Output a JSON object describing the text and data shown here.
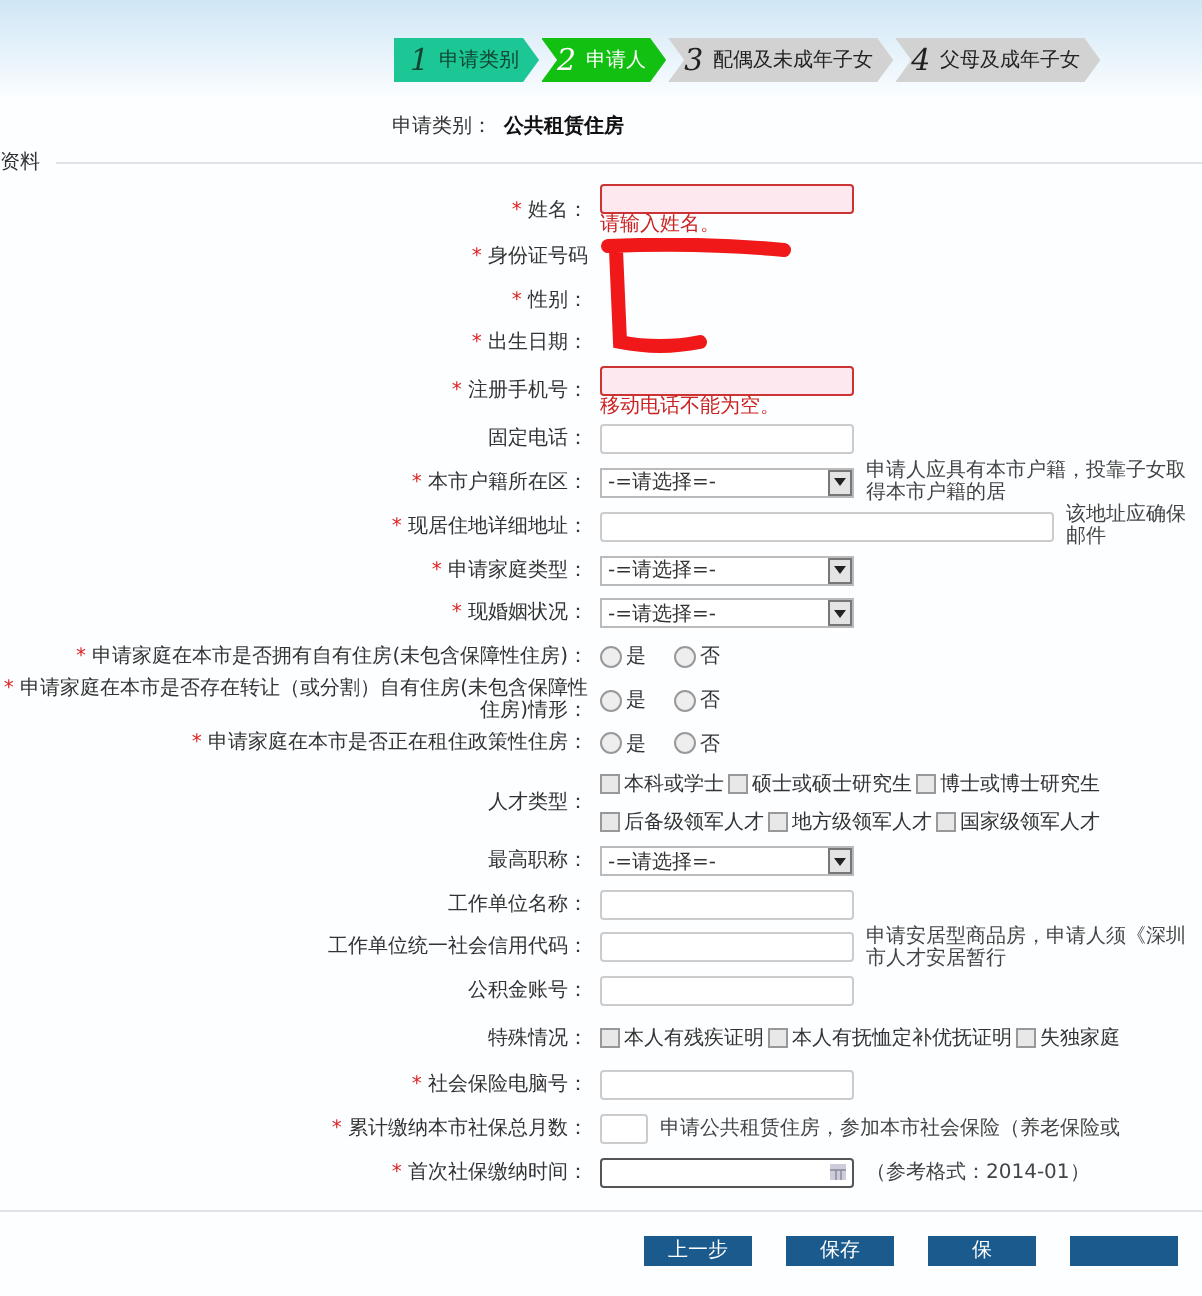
{
  "steps": [
    {
      "number": "1",
      "label": "申请类别",
      "selected": false,
      "done": true
    },
    {
      "number": "2",
      "label": "申请人",
      "selected": true,
      "done": false
    },
    {
      "number": "3",
      "label": "配偶及未成年子女",
      "selected": false,
      "done": false
    },
    {
      "number": "4",
      "label": "父母及成年子女",
      "selected": false,
      "done": false
    }
  ],
  "category": {
    "label": "申请类别：",
    "value": "公共租赁住房"
  },
  "section": {
    "title": "资料"
  },
  "rows": [
    {
      "kind": "text",
      "mark": "*",
      "label": "姓名：",
      "error": true,
      "error_message": "请输入姓名。"
    },
    {
      "kind": "redacted",
      "mark": "*",
      "label": "身份证号码"
    },
    {
      "kind": "redacted",
      "mark": "*",
      "label": "性别："
    },
    {
      "kind": "redacted",
      "mark": "*",
      "label": "出生日期："
    },
    {
      "kind": "text",
      "mark": "*",
      "label": "注册手机号：",
      "error": true,
      "error_message": "移动电话不能为空。"
    },
    {
      "kind": "text",
      "label": "固定电话：",
      "error": false
    },
    {
      "kind": "select",
      "mark": "*",
      "label": "本市户籍所在区：",
      "value": "-=请选择=-",
      "hint": "申请人应具有本市户籍，投靠子女取得本市户籍的居"
    },
    {
      "kind": "wide",
      "mark": "*",
      "label": "现居住地详细地址：",
      "error": false,
      "hint": "该地址应确保邮件"
    },
    {
      "kind": "select",
      "mark": "*",
      "label": "申请家庭类型：",
      "value": "-=请选择=-"
    },
    {
      "kind": "select",
      "mark": "*",
      "label": "现婚姻状况：",
      "value": "-=请选择=-"
    },
    {
      "kind": "radio",
      "mark": "*",
      "label": "申请家庭在本市是否拥有自有住房(未包含保障性住房)：",
      "options": [
        {
          "label": "是",
          "selected": false
        },
        {
          "label": "否",
          "selected": false
        }
      ]
    },
    {
      "kind": "radio",
      "mark": "*",
      "label": "申请家庭在本市是否存在转让（或分割）自有住房(未包含保障性住房)情形：",
      "options": [
        {
          "label": "是",
          "selected": false
        },
        {
          "label": "否",
          "selected": false
        }
      ]
    },
    {
      "kind": "radio",
      "mark": "*",
      "label": "申请家庭在本市是否正在租住政策性住房：",
      "options": [
        {
          "label": "是",
          "selected": false
        },
        {
          "label": "否",
          "selected": false
        }
      ]
    },
    {
      "kind": "checkbox",
      "label": "人才类型：",
      "options": [
        {
          "label": "本科或学士",
          "checked": false
        },
        {
          "label": "硕士或硕士研究生",
          "checked": false
        },
        {
          "label": "博士或博士研究生",
          "checked": false
        },
        {
          "label": "后备级领军人才",
          "checked": false
        },
        {
          "label": "地方级领军人才",
          "checked": false
        },
        {
          "label": "国家级领军人才",
          "checked": false
        }
      ]
    },
    {
      "kind": "select",
      "label": "最高职称：",
      "value": "-=请选择=-"
    },
    {
      "kind": "text",
      "label": "工作单位名称：",
      "error": false
    },
    {
      "kind": "text",
      "label": "工作单位统一社会信用代码：",
      "error": false,
      "hint": "申请安居型商品房，申请人须《深圳市人才安居暂行"
    },
    {
      "kind": "text",
      "label": "公积金账号：",
      "error": false
    },
    {
      "kind": "checkbox",
      "label": "特殊情况：",
      "options": [
        {
          "label": "本人有残疾证明",
          "checked": false
        },
        {
          "label": "本人有抚恤定补优抚证明",
          "checked": false
        },
        {
          "label": "失独家庭",
          "checked": false
        }
      ]
    },
    {
      "kind": "text",
      "mark": "*",
      "label": "社会保险电脑号：",
      "error": false
    },
    {
      "kind": "short",
      "mark": "*",
      "label": "累计缴纳本市社保总月数：",
      "error": false,
      "hint": "申请公共租赁住房，参加本市社会保险（养老保险或"
    },
    {
      "kind": "date",
      "mark": "*",
      "label": "首次社保缴纳时间：",
      "hint": "（参考格式：2014-01）"
    }
  ],
  "buttons": [
    {
      "kind": "action",
      "label": "上一步"
    },
    {
      "kind": "action",
      "label": "保存"
    },
    {
      "kind": "action",
      "label": "保"
    },
    {
      "kind": "action"
    }
  ]
}
